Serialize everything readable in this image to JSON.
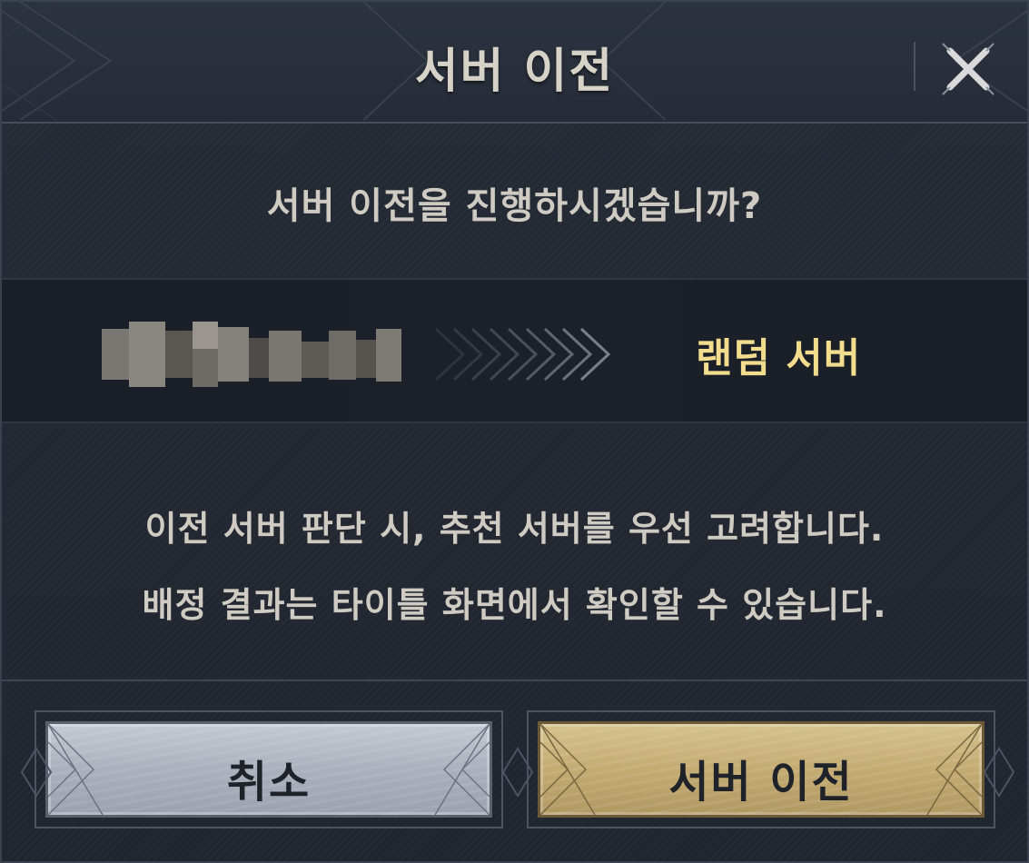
{
  "dialog": {
    "title": "서버 이전",
    "close_icon": "close-icon",
    "question": "서버 이전을 진행하시겠습니까?",
    "current_server_icon": "pixelated-server-name",
    "arrow_icon": "chevrons-right-icon",
    "target_server": "랜덤 서버",
    "info_line_1": "이전 서버 판단 시, 추천 서버를 우선 고려합니다.",
    "info_line_2": "배정 결과는 타이틀 화면에서 확인할 수 있습니다.",
    "cancel_label": "취소",
    "confirm_label": "서버 이전"
  },
  "colors": {
    "background": "#232832",
    "title_text": "#d6d2c8",
    "body_text": "#cfcbc2",
    "highlight_text": "#f2dc8d",
    "cancel_button": "#aab1bc",
    "confirm_button": "#c3ab72"
  }
}
